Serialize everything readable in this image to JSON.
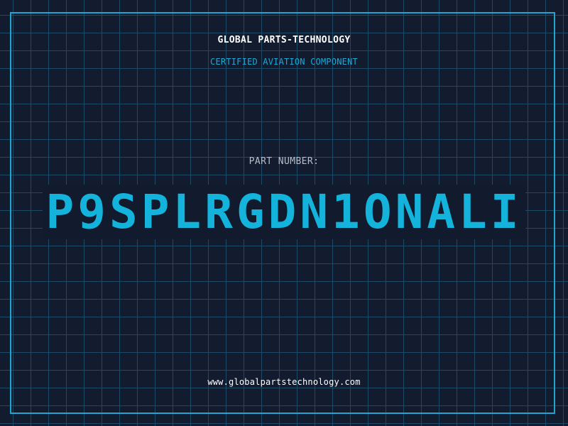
{
  "header": {
    "company": "GLOBAL PARTS-TECHNOLOGY",
    "subtitle": "CERTIFIED AVIATION COMPONENT"
  },
  "part": {
    "label": "PART NUMBER:",
    "number": "P9SPLRGDN1ONALI"
  },
  "footer": {
    "url": "www.globalpartstechnology.com"
  },
  "colors": {
    "background": "#131b2e",
    "grid": "#1d4a66",
    "frame": "#1ea6cf",
    "accent": "#13b3dc"
  }
}
